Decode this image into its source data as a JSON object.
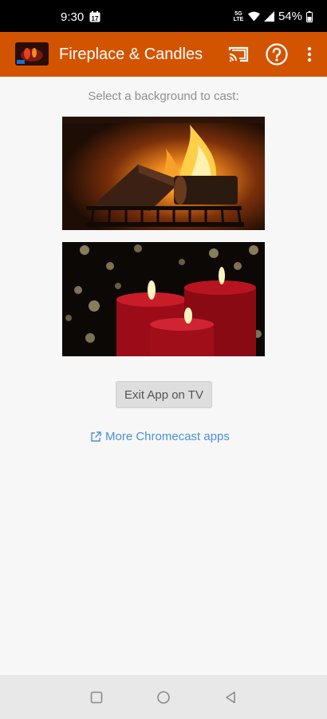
{
  "status_bar": {
    "time": "9:30",
    "calendar_day": "17",
    "network_type_top": "5G",
    "network_type_bottom": "LTE",
    "battery": "54%"
  },
  "app_bar": {
    "title": "Fireplace & Candles",
    "icons": [
      "app-logo",
      "cast-icon",
      "help-icon",
      "more-vert-icon"
    ]
  },
  "main": {
    "prompt": "Select a background to cast:",
    "backgrounds": [
      {
        "name": "fireplace"
      },
      {
        "name": "candles"
      }
    ],
    "exit_button_label": "Exit App on TV",
    "more_link_label": "More Chromecast apps"
  },
  "nav_bar": {
    "icons": [
      "recents-icon",
      "home-icon",
      "back-icon"
    ]
  },
  "colors": {
    "app_bar": "#d35400",
    "link": "#4a90d9",
    "background": "#f7f7f7"
  }
}
